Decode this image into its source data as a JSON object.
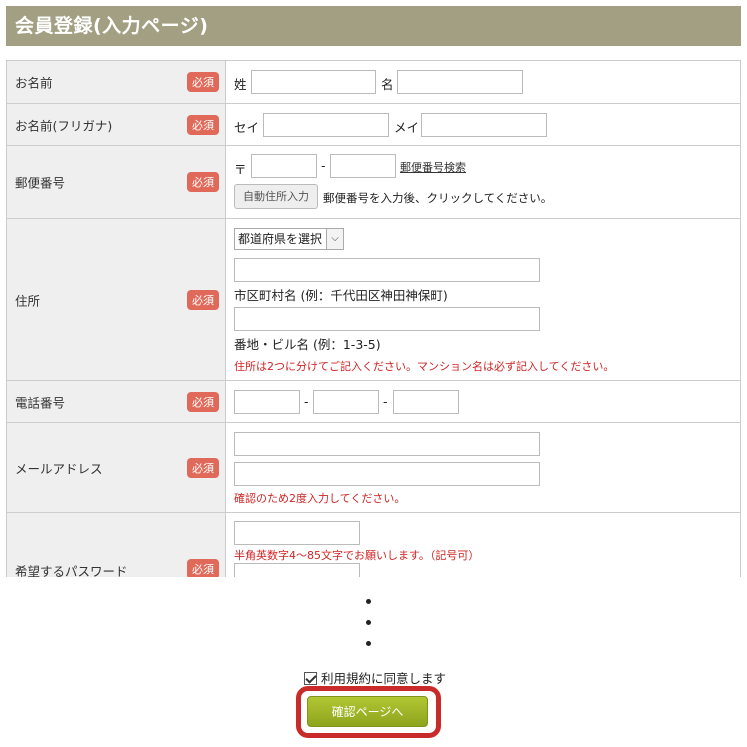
{
  "page": {
    "title": "会員登録(入力ページ)"
  },
  "required_label": "必須",
  "rows": {
    "name": {
      "label": "お名前",
      "sei": "姓",
      "mei": "名"
    },
    "kana": {
      "label": "お名前(フリガナ)",
      "sei": "セイ",
      "mei": "メイ"
    },
    "postal": {
      "label": "郵便番号",
      "prefix": "〒",
      "sep": "-",
      "search_link": "郵便番号検索",
      "auto_button": "自動住所入力",
      "hint": "郵便番号を入力後、クリックしてください。"
    },
    "address": {
      "label": "住所",
      "prefecture_select": "都道府県を選択",
      "city_hint": "市区町村名 (例：千代田区神田神保町)",
      "street_hint": "番地・ビル名 (例：1-3-5)",
      "note": "住所は2つに分けてご記入ください。マンション名は必ず記入してください。"
    },
    "phone": {
      "label": "電話番号",
      "sep": "-"
    },
    "email": {
      "label": "メールアドレス",
      "note": "確認のため2度入力してください。"
    },
    "password": {
      "label": "希望するパスワード",
      "note": "半角英数字4～85文字でお願いします。（記号可）"
    }
  },
  "agree": {
    "label": "利用規約に同意します",
    "checked": true
  },
  "submit": {
    "label": "確認ページへ"
  },
  "colors": {
    "header_bg": "#a39f83",
    "badge_bg": "#e0695a",
    "note_red": "#d02424",
    "submit_green": "#9bb126",
    "highlight_red": "#c92b2b"
  }
}
